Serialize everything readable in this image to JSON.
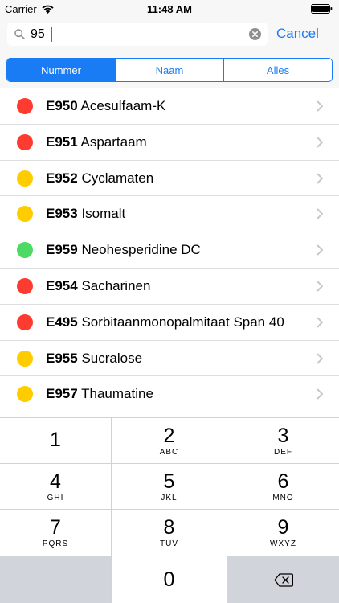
{
  "status": {
    "carrier": "Carrier",
    "time": "11:48 AM"
  },
  "search": {
    "value": "95",
    "cancel_label": "Cancel"
  },
  "segments": [
    {
      "label": "Nummer",
      "active": true
    },
    {
      "label": "Naam",
      "active": false
    },
    {
      "label": "Alles",
      "active": false
    }
  ],
  "colors": {
    "accent": "#1a7cf5",
    "red": "#fd3b30",
    "yellow": "#ffcc00",
    "green": "#4cd964"
  },
  "items": [
    {
      "code": "E950",
      "name": "Acesulfaam-K",
      "status": "red"
    },
    {
      "code": "E951",
      "name": "Aspartaam",
      "status": "red"
    },
    {
      "code": "E952",
      "name": "Cyclamaten",
      "status": "yellow"
    },
    {
      "code": "E953",
      "name": "Isomalt",
      "status": "yellow"
    },
    {
      "code": "E959",
      "name": "Neohesperidine DC",
      "status": "green"
    },
    {
      "code": "E954",
      "name": "Sacharinen",
      "status": "red"
    },
    {
      "code": "E495",
      "name": "Sorbitaanmonopalmitaat Span 40",
      "status": "red"
    },
    {
      "code": "E955",
      "name": "Sucralose",
      "status": "yellow"
    },
    {
      "code": "E957",
      "name": "Thaumatine",
      "status": "yellow"
    }
  ],
  "keypad": [
    {
      "num": "1",
      "letters": ""
    },
    {
      "num": "2",
      "letters": "ABC"
    },
    {
      "num": "3",
      "letters": "DEF"
    },
    {
      "num": "4",
      "letters": "GHI"
    },
    {
      "num": "5",
      "letters": "JKL"
    },
    {
      "num": "6",
      "letters": "MNO"
    },
    {
      "num": "7",
      "letters": "PQRS"
    },
    {
      "num": "8",
      "letters": "TUV"
    },
    {
      "num": "9",
      "letters": "WXYZ"
    },
    {
      "num": "0",
      "letters": ""
    }
  ]
}
